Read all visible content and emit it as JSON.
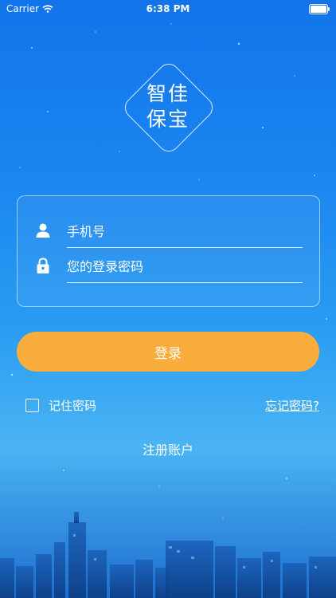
{
  "status_bar": {
    "carrier": "Carrier",
    "time": "6:38 PM"
  },
  "logo": {
    "line1": "智佳",
    "line2": "保宝"
  },
  "login_form": {
    "phone_placeholder": "手机号",
    "password_placeholder": "您的登录密码",
    "phone_icon": "user-icon",
    "password_icon": "lock-icon"
  },
  "actions": {
    "login_label": "登录",
    "remember_label": "记住密码",
    "remember_checked": false,
    "forgot_label": "忘记密码?",
    "register_label": "注册账户"
  },
  "colors": {
    "background_top": "#1274ea",
    "background_mid": "#2a9cf2",
    "login_button": "#f9ad3c",
    "text": "#ffffff"
  }
}
